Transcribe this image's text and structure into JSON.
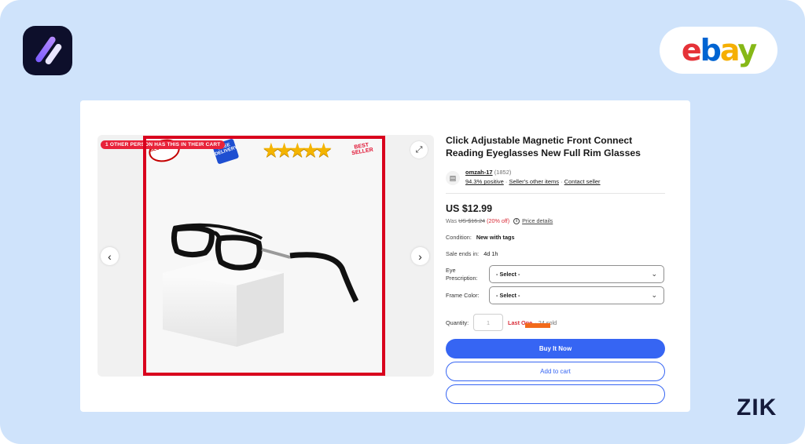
{
  "branding": {
    "app_logo": "zik-analytics-logo",
    "marketplace": {
      "letters": [
        "e",
        "b",
        "a",
        "y"
      ],
      "colors": [
        "#e53238",
        "#0064d2",
        "#f5af02",
        "#86b817"
      ]
    },
    "watermark": "ZIK"
  },
  "gallery": {
    "cart_banner": "1 OTHER PERSON HAS THIS IN THEIR CART",
    "badges": {
      "best_price": "BEST PRICE",
      "free_delivery": "FREE DELIVERY",
      "stars": "★★★★★",
      "best_seller": "BEST SELLER"
    },
    "icons": {
      "expand": "expand-icon",
      "prev": "chevron-left-icon",
      "next": "chevron-right-icon"
    },
    "highlight_color": "#d9001d"
  },
  "listing": {
    "title": "Click Adjustable Magnetic Front Connect Reading Eyeglasses New Full Rim Glasses",
    "seller": {
      "name": "omzah-17",
      "feedback_count": "(1852)",
      "positive": "94.3% positive",
      "separator": "·",
      "other_items": "Seller's other items",
      "contact": "Contact seller"
    },
    "price": "US $12.99",
    "was": {
      "label": "Was",
      "amount": "US $16.24",
      "off": "(20% off)",
      "price_details": "Price details"
    },
    "condition": {
      "key": "Condition:",
      "value": "New with tags"
    },
    "sale_ends": {
      "key": "Sale ends in:",
      "value": "4d 1h"
    },
    "options": [
      {
        "label": "Eye Prescription:",
        "value": "- Select -"
      },
      {
        "label": "Frame Color:",
        "value": "- Select -"
      }
    ],
    "quantity": {
      "label": "Quantity:",
      "value": "1",
      "last_one": "Last One",
      "sold": "· 24 sold",
      "sold_highlight_color": "#f26a1b"
    },
    "buttons": {
      "buy_now": "Buy It Now",
      "add_to_cart": "Add to cart"
    },
    "accent_color": "#3665f3"
  }
}
